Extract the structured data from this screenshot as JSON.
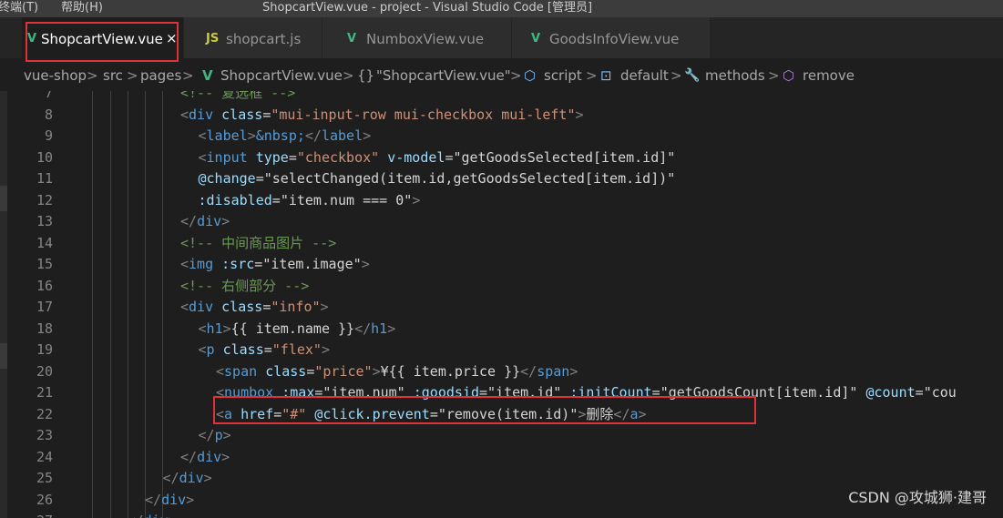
{
  "window": {
    "menu_terminal": "终端(T)",
    "menu_help": "帮助(H)",
    "title": "ShopcartView.vue - project - Visual Studio Code [管理员]"
  },
  "tabs": [
    {
      "label": "ShopcartView.vue",
      "icon": "vue-icon",
      "icon_glyph": "V",
      "icon_color": "#41b883",
      "active": true
    },
    {
      "label": "shopcart.js",
      "icon": "js-icon",
      "icon_glyph": "JS",
      "icon_color": "#cbcb41",
      "active": false
    },
    {
      "label": "NumboxView.vue",
      "icon": "vue-icon",
      "icon_glyph": "V",
      "icon_color": "#41b883",
      "active": false
    },
    {
      "label": "GoodsInfoView.vue",
      "icon": "vue-icon",
      "icon_glyph": "V",
      "icon_color": "#41b883",
      "active": false
    }
  ],
  "breadcrumbs": {
    "items": [
      "vue-shop",
      "src",
      "pages",
      "ShopcartView.vue",
      "\"ShopcartView.vue\"",
      "script",
      "default",
      "methods",
      "remove"
    ],
    "glyphs": [
      "",
      "",
      "",
      "V",
      "{}",
      "⬡",
      "⊡",
      "🔧",
      "⬡"
    ],
    "separator": ">"
  },
  "editor": {
    "lines": [
      {
        "n": "7",
        "indent": 0,
        "html": "<span class='t-cmt'>&lt;!-- 复选框 --&gt;</span>"
      },
      {
        "n": "8",
        "indent": 0,
        "html": "<span class='t-punct'>&lt;</span><span class='t-tag'>div</span> <span class='t-attr'>class</span><span class='t-txt'>=</span><span class='t-str'>\"mui-input-row mui-checkbox mui-left\"</span><span class='t-punct'>&gt;</span>"
      },
      {
        "n": "9",
        "indent": 1,
        "html": "<span class='t-punct'>&lt;</span><span class='t-tag'>label</span><span class='t-punct'>&gt;</span><span class='t-ent'>&amp;nbsp;</span><span class='t-punct'>&lt;/</span><span class='t-tag'>label</span><span class='t-punct'>&gt;</span>"
      },
      {
        "n": "10",
        "indent": 1,
        "html": "<span class='t-punct'>&lt;</span><span class='t-tag'>input</span> <span class='t-attr'>type</span><span class='t-txt'>=</span><span class='t-str'>\"checkbox\"</span> <span class='t-attr'>v-model</span><span class='t-txt'>=</span><span class='t-txt'>\"getGoodsSelected[item.id]\"</span>"
      },
      {
        "n": "11",
        "indent": 1,
        "html": "<span class='t-attr'>@change</span><span class='t-txt'>=</span><span class='t-txt'>\"selectChanged(item.id,getGoodsSelected[item.id])\"</span>"
      },
      {
        "n": "12",
        "indent": 1,
        "html": "<span class='t-attr'>:disabled</span><span class='t-txt'>=</span><span class='t-txt'>\"item.num === 0\"</span><span class='t-punct'>&gt;</span>"
      },
      {
        "n": "13",
        "indent": 0,
        "html": "<span class='t-punct'>&lt;/</span><span class='t-tag'>div</span><span class='t-punct'>&gt;</span>"
      },
      {
        "n": "14",
        "indent": 0,
        "html": "<span class='t-cmt'>&lt;!-- 中间商品图片 --&gt;</span>"
      },
      {
        "n": "15",
        "indent": 0,
        "html": "<span class='t-punct'>&lt;</span><span class='t-tag'>img</span> <span class='t-attr'>:src</span><span class='t-txt'>=</span><span class='t-txt'>\"item.image\"</span><span class='t-punct'>&gt;</span>"
      },
      {
        "n": "16",
        "indent": 0,
        "html": "<span class='t-cmt'>&lt;!-- 右侧部分 --&gt;</span>"
      },
      {
        "n": "17",
        "indent": 0,
        "html": "<span class='t-punct'>&lt;</span><span class='t-tag'>div</span> <span class='t-attr'>class</span><span class='t-txt'>=</span><span class='t-str'>\"info\"</span><span class='t-punct'>&gt;</span>"
      },
      {
        "n": "18",
        "indent": 1,
        "html": "<span class='t-punct'>&lt;</span><span class='t-tag'>h1</span><span class='t-punct'>&gt;</span><span class='t-txt'>{{ item.name }}</span><span class='t-punct'>&lt;/</span><span class='t-tag'>h1</span><span class='t-punct'>&gt;</span>"
      },
      {
        "n": "19",
        "indent": 1,
        "html": "<span class='t-punct'>&lt;</span><span class='t-tag'>p</span> <span class='t-attr'>class</span><span class='t-txt'>=</span><span class='t-str'>\"flex\"</span><span class='t-punct'>&gt;</span>"
      },
      {
        "n": "20",
        "indent": 2,
        "html": "<span class='t-punct'>&lt;</span><span class='t-tag'>span</span> <span class='t-attr'>class</span><span class='t-txt'>=</span><span class='t-str'>\"price\"</span><span class='t-punct'>&gt;</span><span class='t-txt'>¥{{ item.price }}</span><span class='t-punct'>&lt;/</span><span class='t-tag'>span</span><span class='t-punct'>&gt;</span>"
      },
      {
        "n": "21",
        "indent": 2,
        "html": "<span class='t-punct'>&lt;</span><span class='t-tag'>numbox</span> <span class='t-attr'>:max</span><span class='t-txt'>=</span><span class='t-txt'>\"item.num\"</span> <span class='t-attr'>:goodsid</span><span class='t-txt'>=</span><span class='t-txt'>\"item.id\"</span> <span class='t-attr'>:initCount</span><span class='t-txt'>=</span><span class='t-txt'>\"getGoodsCount[item.id]\"</span> <span class='t-attr'>@count</span><span class='t-txt'>=</span><span class='t-txt'>\"cou</span>"
      },
      {
        "n": "22",
        "indent": 2,
        "html": "<span class='t-punct'>&lt;</span><span class='t-tag'>a</span> <span class='t-attr'>href</span><span class='t-txt'>=</span><span class='t-str'>\"#\"</span> <span class='t-attr'>@click.prevent</span><span class='t-txt'>=</span><span class='t-txt'>\"remove(item.id)\"</span><span class='t-punct'>&gt;</span><span class='t-txt'>删除</span><span class='t-punct'>&lt;/</span><span class='t-tag'>a</span><span class='t-punct'>&gt;</span>"
      },
      {
        "n": "23",
        "indent": 1,
        "html": "<span class='t-punct'>&lt;/</span><span class='t-tag'>p</span><span class='t-punct'>&gt;</span>"
      },
      {
        "n": "24",
        "indent": 0,
        "html": "<span class='t-punct'>&lt;/</span><span class='t-tag'>div</span><span class='t-punct'>&gt;</span>"
      },
      {
        "n": "25",
        "indent": -1,
        "html": "<span class='t-punct'>&lt;/</span><span class='t-tag'>div</span><span class='t-punct'>&gt;</span>"
      },
      {
        "n": "26",
        "indent": -2,
        "html": "<span class='t-punct'>&lt;/</span><span class='t-tag'>div</span><span class='t-punct'>&gt;</span>"
      },
      {
        "n": "27",
        "indent": -3,
        "html": "<span class='t-punct'>&lt;/</span><span class='t-tag'>div</span><span class='t-punct'>&gt;</span>"
      }
    ]
  },
  "watermark": "CSDN @攻城狮·建哥",
  "colors": {
    "highlight_box": "#e0323a",
    "vue_green": "#41b883",
    "js_yellow": "#cbcb41"
  }
}
